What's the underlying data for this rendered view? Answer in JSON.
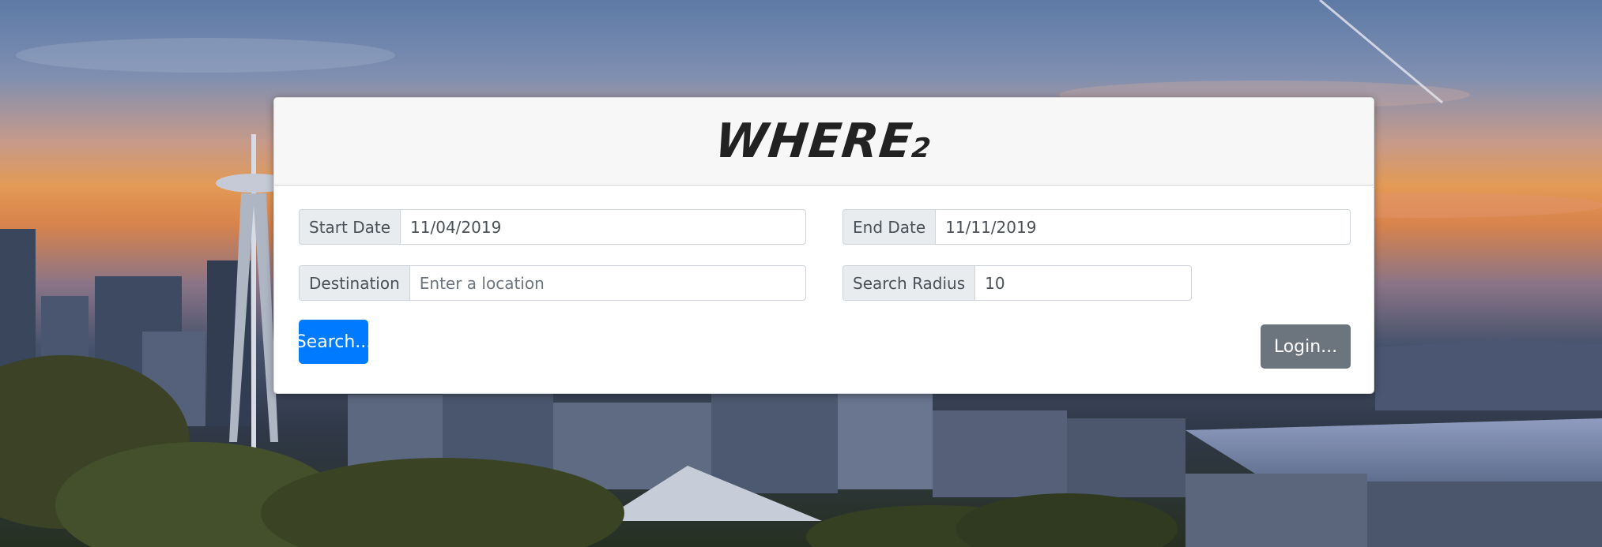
{
  "app": {
    "brand": "WHERE",
    "brand_suffix": "2"
  },
  "form": {
    "start_date": {
      "label": "Start Date",
      "value": "11/04/2019"
    },
    "end_date": {
      "label": "End Date",
      "value": "11/11/2019"
    },
    "destination": {
      "label": "Destination",
      "value": "",
      "placeholder": "Enter a location"
    },
    "search_radius": {
      "label": "Search Radius",
      "value": "10"
    }
  },
  "actions": {
    "search_label": "Search...",
    "login_label": "Login..."
  },
  "colors": {
    "primary": "#007bff",
    "secondary": "#6c757d",
    "header_bg": "#f7f7f7"
  }
}
